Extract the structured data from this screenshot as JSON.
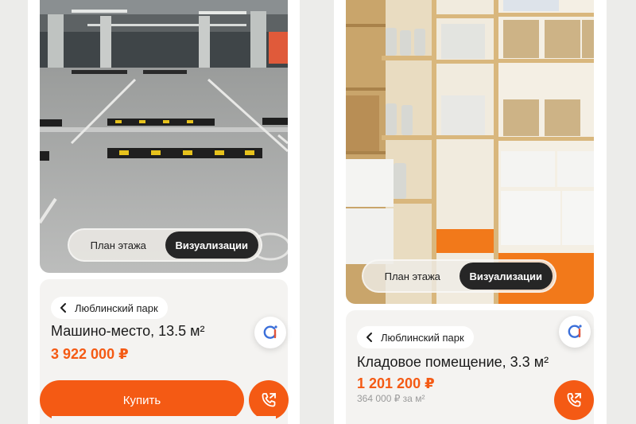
{
  "left_screen": {
    "segment": {
      "option_plan": "План этажа",
      "option_visual": "Визуализации",
      "active": "option_visual"
    },
    "card": {
      "location_chip": "Люблинский парк",
      "title": "Машино-место, 13.5 м²",
      "price": "3 922 000 ₽"
    },
    "buy_button": "Купить",
    "icons": {
      "back": "chevron-left-icon",
      "ai": "ai-assistant-icon",
      "call": "phone-call-icon"
    }
  },
  "right_screen": {
    "segment": {
      "option_plan": "План этажа",
      "option_visual": "Визуализации",
      "active": "option_visual"
    },
    "card": {
      "location_chip": "Люблинский парк",
      "title": "Кладовое помещение, 3.3 м²",
      "price": "1 201 200 ₽",
      "price_per_m2": "364 000 ₽ за м²"
    },
    "icons": {
      "back": "chevron-left-icon",
      "ai": "ai-assistant-icon",
      "call": "phone-call-icon"
    }
  },
  "colors": {
    "accent": "#f45a14",
    "segment_active": "#262626",
    "card_bg": "#f4f3f1",
    "page_bg": "#ececea"
  }
}
